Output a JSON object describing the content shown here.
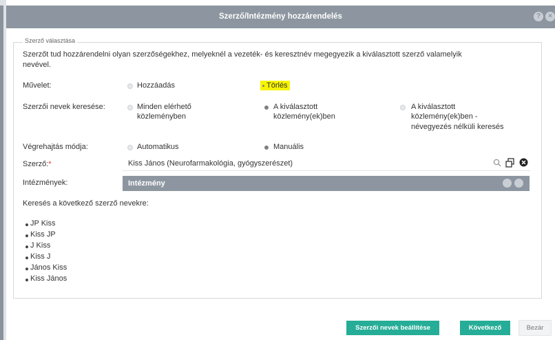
{
  "dialog": {
    "title": "Szerző/Intézmény hozzárendelés"
  },
  "fieldset": {
    "legend": "Szerző választása",
    "description_line1": "Szerzőt tud hozzárendelni olyan szerzőségekhez, melyeknél a vezeték- és keresztnév megegyezik a kiválasztott szerző valamelyik",
    "description_line2": "nevével."
  },
  "muvelet": {
    "label": "Művelet:",
    "options": [
      "Hozzáadás",
      "Törlés"
    ],
    "selected": "Törlés"
  },
  "kereses": {
    "label": "Szerzői nevek keresése:",
    "opt1_line1": "Minden elérhető",
    "opt1_line2": "közleményben",
    "opt2_line1": "A kiválasztott",
    "opt2_line2": "közlemény(ek)ben",
    "opt3_line1": "A kiválasztott",
    "opt3_line2": "közlemény(ek)ben -",
    "opt3_line3": "névegyezés nélküli keresés",
    "selected": "A kiválasztott közlemény(ek)ben"
  },
  "mod": {
    "label": "Végrehajtás módja:",
    "options": [
      "Automatikus",
      "Manuális"
    ],
    "selected": "Manuális"
  },
  "szerzo": {
    "label": "Szerző:",
    "required_mark": "*",
    "value": "Kiss János (Neurofarmakológia, gyógyszerészet)"
  },
  "intezmenyek": {
    "label": "Intézmények:",
    "header": "Intézmény"
  },
  "names": {
    "heading": "Keresés a következő szerző nevekre:",
    "items": [
      "JP Kiss",
      "Kiss JP",
      "J Kiss",
      "Kiss J",
      "János Kiss",
      "Kiss János"
    ]
  },
  "buttons": {
    "set_names": "Szerzői nevek beállítése",
    "next": "Következő",
    "close": "Bezár"
  },
  "colors": {
    "header": "#8d96a0",
    "accent": "#26ad97",
    "highlight": "#f7f400"
  }
}
